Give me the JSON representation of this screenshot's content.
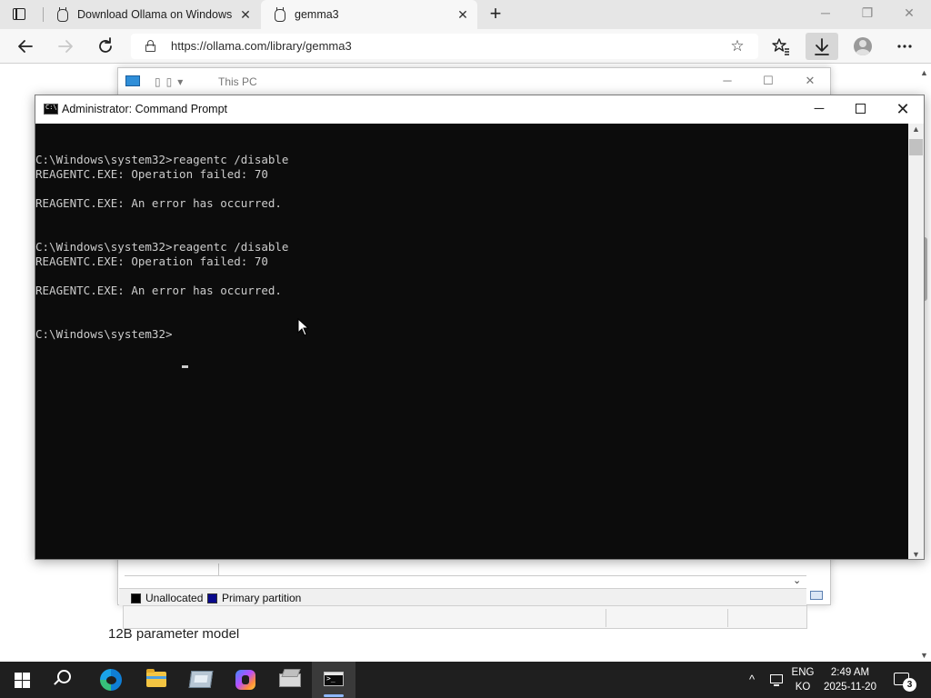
{
  "browser": {
    "tabs": [
      {
        "title": "Download Ollama on Windows",
        "active": false
      },
      {
        "title": "gemma3",
        "active": true
      }
    ],
    "new_tab_symbol": "+",
    "url": "https://ollama.com/library/gemma3",
    "icons": {
      "tab_actions": "tab-actions-icon",
      "tab_favicon": "ollama-favicon",
      "close": "close-icon",
      "back": "arrow-left-icon",
      "forward": "arrow-right-icon",
      "reload": "reload-icon",
      "lock": "lock-icon",
      "add_favorite": "star-plus-icon",
      "favorites": "favorites-icon",
      "downloads": "download-icon",
      "profile": "avatar-icon",
      "menu": "more-icon"
    }
  },
  "page": {
    "model_caption": "12B parameter model"
  },
  "background_window": {
    "title": "This PC",
    "legend": [
      {
        "label": "Unallocated",
        "color": "#000000"
      },
      {
        "label": "Primary partition",
        "color": "#0a0a8c"
      }
    ]
  },
  "cmd": {
    "title": "Administrator: Command Prompt",
    "lines": [
      "",
      "C:\\Windows\\system32>reagentc /disable",
      "REAGENTC.EXE: Operation failed: 70",
      "",
      "REAGENTC.EXE: An error has occurred.",
      "",
      "",
      "C:\\Windows\\system32>reagentc /disable",
      "REAGENTC.EXE: Operation failed: 70",
      "",
      "REAGENTC.EXE: An error has occurred.",
      "",
      "",
      "C:\\Windows\\system32>"
    ],
    "colors": {
      "background": "#0c0c0c",
      "text": "#cccccc"
    }
  },
  "taskbar": {
    "apps": [
      {
        "name": "start",
        "icon": "windows-logo-icon"
      },
      {
        "name": "search",
        "icon": "search-icon"
      },
      {
        "name": "edge",
        "icon": "edge-icon"
      },
      {
        "name": "file-explorer",
        "icon": "folder-icon"
      },
      {
        "name": "disk-management",
        "icon": "disk-icon"
      },
      {
        "name": "copilot",
        "icon": "copilot-icon"
      },
      {
        "name": "setup",
        "icon": "package-icon"
      },
      {
        "name": "command-prompt",
        "icon": "terminal-icon",
        "active": true
      }
    ],
    "tray": {
      "chevron": "^",
      "lang_top": "ENG",
      "lang_bottom": "KO",
      "time": "2:49 AM",
      "date": "2025-11-20",
      "notification_count": "3"
    }
  }
}
